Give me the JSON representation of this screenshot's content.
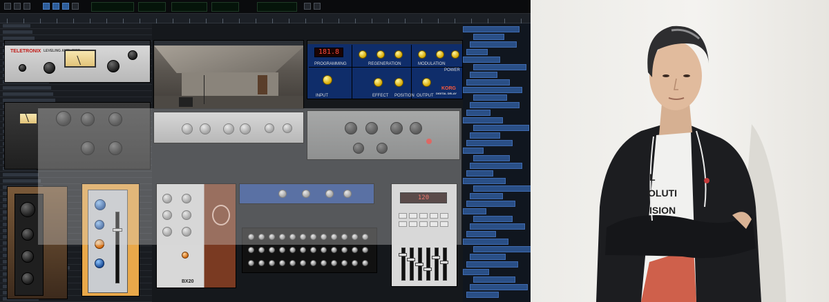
{
  "plugins": {
    "limiter": {
      "brand": "TELETRONIX",
      "subtitle": "LEVELING AMPLIFIER"
    },
    "delay": {
      "display": "181.8",
      "brand": "KORG",
      "model": "DIGITAL DELAY",
      "sections": [
        "PROGRAMMING",
        "REGENERATION",
        "MODULATION",
        "INPUT",
        "EFFECT",
        "POSITION",
        "OUTPUT",
        "POWER"
      ]
    },
    "spring": {
      "model": "BX20"
    },
    "drum": {
      "display": "120"
    }
  },
  "colors": {
    "delay_panel": "#0f2d6a",
    "delay_knob": "#e0b400",
    "wood": "#7a3a22",
    "overlay": "rgba(215,215,215,0.34)"
  },
  "photo": {
    "shirt_text": [
      "L",
      "OLUTI",
      "ISION"
    ]
  }
}
